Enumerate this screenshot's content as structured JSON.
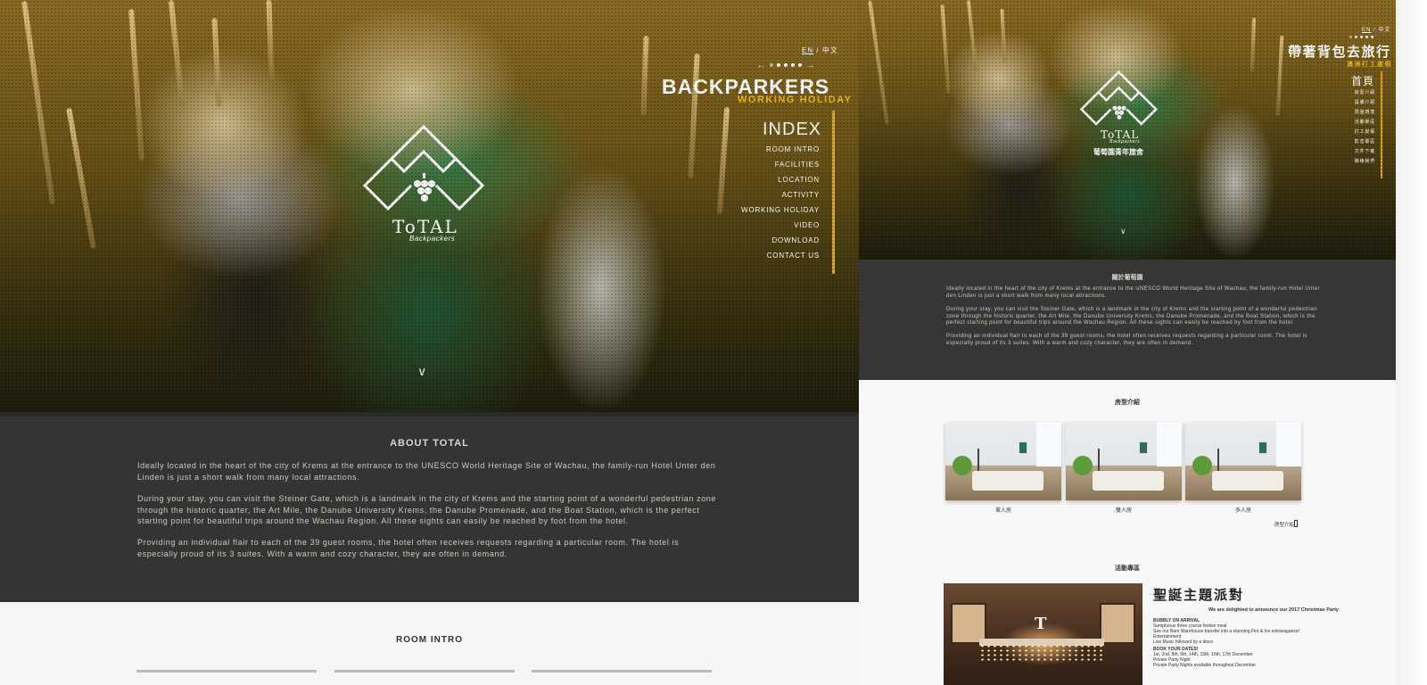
{
  "left_page": {
    "lang": {
      "en": "EN",
      "sep": "/",
      "zh": "中文"
    },
    "brand": {
      "title": "BACKPARKERS",
      "subtitle": "WORKING HOLIDAY"
    },
    "menu": {
      "index": "INDEX",
      "items": [
        "ROOM INTRO",
        "FACILITIES",
        "LOCATION",
        "ACTIVITY",
        "WORKING HOLIDAY",
        "VIDEO",
        "DOWNLOAD",
        "CONTACT US"
      ]
    },
    "pager": {
      "prev": "←",
      "next": "→",
      "count": 5
    },
    "logo": {
      "text": "ToTAL",
      "sub": "Backpackers"
    },
    "scroll": "∨",
    "about": {
      "title": "ABOUT TOTAL",
      "paragraphs": [
        "Ideally located in the heart of the city of Krems at the entrance to the UNESCO World Heritage Site of Wachau, the family-run Hotel Unter den Linden is just a short walk from many local attractions.",
        "During your stay, you can visit the Steiner Gate, which is a landmark in the city of Krems and the starting point of a wonderful pedestrian zone through the historic quarter, the Art Mile, the Danube University Krems, the Danube Promenade, and the Boat Station, which is the perfect starting point for beautiful trips around the Wachau Region. All these sights can easily be reached by foot from the hotel.",
        "Providing an individual flair to each of the 39 guest rooms, the hotel often receives requests regarding a particular room. The hotel is especially proud of its 3 suites. With a warm and cozy character, they are often in demand."
      ]
    },
    "room_intro": {
      "title": "ROOM INTRO"
    }
  },
  "right_page": {
    "lang": {
      "en": "EN",
      "sep": "/",
      "zh": "中文"
    },
    "brand": {
      "title": "帶著背包去旅行",
      "subtitle": "澳洲打工度假"
    },
    "menu": {
      "index": "首頁",
      "items": [
        "房型介紹",
        "設備介紹",
        "周邊環境",
        "活動專區",
        "打工度假",
        "影音專區",
        "文件下載",
        "聯絡我們"
      ]
    },
    "logo": {
      "text": "ToTAL",
      "sub": "Backpackers",
      "zh": "葡萄園青年旅舍"
    },
    "scroll": "∨",
    "about": {
      "title": "關於葡萄園",
      "paragraphs": [
        "Ideally located in the heart of the city of Krems at the entrance to the UNESCO World Heritage Site of Wachau, the family-run Hotel Unter den Linden is just a short walk from many local attractions.",
        "During your stay, you can visit the Steiner Gate, which is a landmark in the city of Krems and the starting point of a wonderful pedestrian zone through the historic quarter, the Art Mile, the Danube University Krems, the Danube Promenade, and the Boat Station, which is the perfect starting point for beautiful trips around the Wachau Region. All these sights can easily be reached by foot from the hotel.",
        "Providing an individual flair to each of the 39 guest rooms, the hotel often receives requests regarding a particular room. The hotel is especially proud of its 3 suites. With a warm and cozy character, they are often in demand."
      ]
    },
    "rooms": {
      "title": "房型介紹",
      "cards": [
        {
          "label": "單人房"
        },
        {
          "label": "雙人房"
        },
        {
          "label": "多人房"
        }
      ],
      "more": "房型介紹"
    },
    "activity": {
      "title": "活動專區",
      "event_title": "聖誕主題派對",
      "intro": "We are delighted to announce our 2017 Christmas Party",
      "lines": [
        {
          "text": "BUBBLY ON ARRIVAL",
          "bold": true
        },
        {
          "text": "Sumptuous three course festive meal",
          "bold": false
        },
        {
          "text": "See our Barn Warehouse transfer into a stunning Fire & Ice extravaganza!",
          "bold": false
        },
        {
          "text": "Entertainment",
          "bold": false
        },
        {
          "text": "Live Music followed by a disco",
          "bold": false
        },
        {
          "text": "BOOK YOUR DATES!",
          "bold": true
        },
        {
          "text": "1st, 2nd, 8th, 9th, 14th, 15th, 16th, 17th December",
          "bold": false
        },
        {
          "text": "Private Party Night",
          "bold": false
        },
        {
          "text": "Private Party Nights available throughout December",
          "bold": false
        }
      ]
    }
  }
}
